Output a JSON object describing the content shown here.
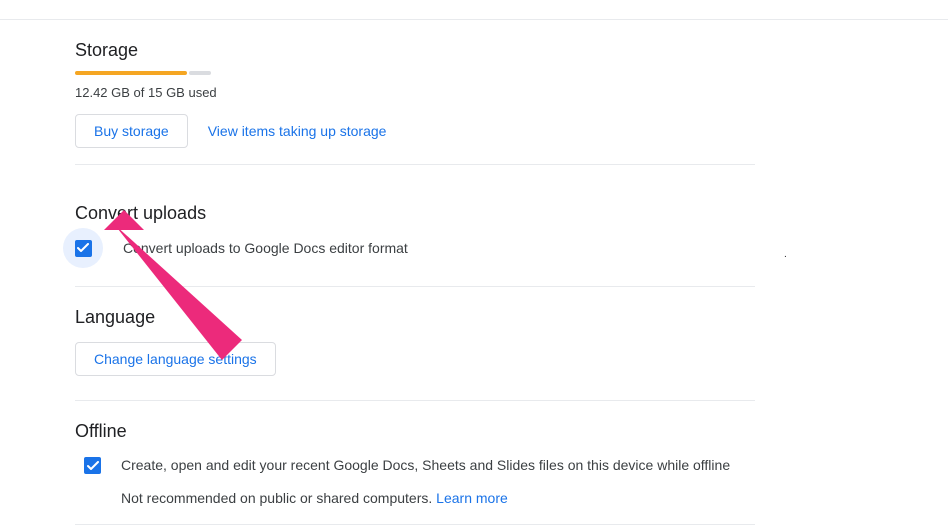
{
  "storage": {
    "title": "Storage",
    "usage_text": "12.42 GB of 15 GB used",
    "buy_label": "Buy storage",
    "view_items_label": "View items taking up storage"
  },
  "convert": {
    "title": "Convert uploads",
    "checkbox_label": "Convert uploads to Google Docs editor format"
  },
  "language": {
    "title": "Language",
    "button_label": "Change language settings"
  },
  "offline": {
    "title": "Offline",
    "checkbox_label": "Create, open and edit your recent Google Docs, Sheets and Slides files on this device while offline",
    "note_text": "Not recommended on public or shared computers. ",
    "learn_more_label": "Learn more"
  }
}
